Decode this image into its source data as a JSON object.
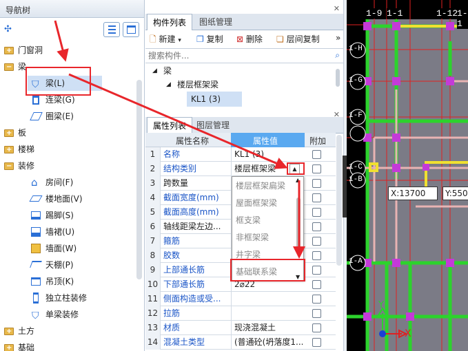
{
  "nav": {
    "title": "导航树",
    "items": [
      {
        "label": "门窗洞"
      },
      {
        "label": "梁"
      },
      {
        "label": "梁(L)"
      },
      {
        "label": "连梁(G)"
      },
      {
        "label": "圈梁(E)"
      },
      {
        "label": "板"
      },
      {
        "label": "楼梯"
      },
      {
        "label": "装修"
      },
      {
        "label": "房间(F)"
      },
      {
        "label": "楼地面(V)"
      },
      {
        "label": "踢脚(S)"
      },
      {
        "label": "墙裙(U)"
      },
      {
        "label": "墙面(W)"
      },
      {
        "label": "天棚(P)"
      },
      {
        "label": "吊顶(K)"
      },
      {
        "label": "独立柱装修"
      },
      {
        "label": "单梁装修"
      },
      {
        "label": "土方"
      },
      {
        "label": "基础"
      }
    ]
  },
  "component_panel": {
    "tabs": [
      "构件列表",
      "图纸管理"
    ],
    "toolbar": {
      "new": "新建",
      "copy": "复制",
      "delete": "删除",
      "floor_copy": "层间复制"
    },
    "search_placeholder": "搜索构件...",
    "tree": [
      "梁",
      "楼层框架梁",
      "KL1 (3)"
    ]
  },
  "property_panel": {
    "tabs": [
      "属性列表",
      "图层管理"
    ],
    "headers": {
      "name": "属性名称",
      "value": "属性值",
      "extra": "附加"
    },
    "rows": [
      {
        "num": "1",
        "name": "名称",
        "value": "KL1 (3)"
      },
      {
        "num": "2",
        "name": "结构类别",
        "value": "楼层框架梁"
      },
      {
        "num": "3",
        "name": "跨数量",
        "value": ""
      },
      {
        "num": "4",
        "name": "截面宽度(mm)",
        "value": ""
      },
      {
        "num": "5",
        "name": "截面高度(mm)",
        "value": ""
      },
      {
        "num": "6",
        "name": "轴线距梁左边...",
        "value": ""
      },
      {
        "num": "7",
        "name": "箍筋",
        "value": ""
      },
      {
        "num": "8",
        "name": "胶数",
        "value": ""
      },
      {
        "num": "9",
        "name": "上部通长筋",
        "value": ""
      },
      {
        "num": "10",
        "name": "下部通长筋",
        "value": "2⌀22"
      },
      {
        "num": "11",
        "name": "侧面构造或受...",
        "value": ""
      },
      {
        "num": "12",
        "name": "拉筋",
        "value": ""
      },
      {
        "num": "13",
        "name": "材质",
        "value": "现浇混凝土"
      },
      {
        "num": "14",
        "name": "混凝土类型",
        "value": "(普通砼(坍落度1..."
      }
    ],
    "dropdown_options": [
      "楼层框架扁梁",
      "屋面框架梁",
      "框支梁",
      "非框架梁",
      "井字梁",
      "基础联系梁"
    ]
  },
  "canvas": {
    "top_labels": [
      "1-9",
      "1-1",
      "1-12",
      "1-1"
    ],
    "axis_labels": [
      "1-H",
      "1-G",
      "1-F",
      "1-C",
      "1-B",
      "1-A"
    ],
    "coord_x": "X:13700",
    "coord_y": "Y:550",
    "y_axis": "Y",
    "x_axis": "X"
  },
  "colors": {
    "accent": "#1a55c7",
    "annotation": "#e8262b",
    "beam": "#2cd32c",
    "column": "#c43ad8",
    "grid": "#e02020"
  }
}
